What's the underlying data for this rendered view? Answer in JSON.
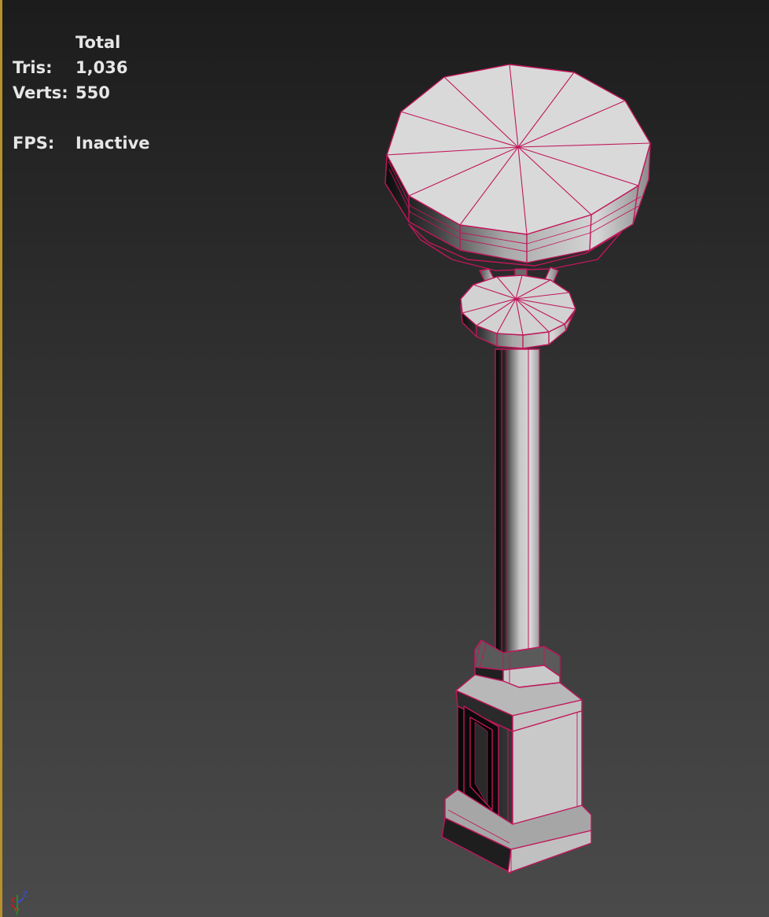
{
  "stats": {
    "column_header": "Total",
    "tris_label": "Tris:",
    "tris_value": "1,036",
    "verts_label": "Verts:",
    "verts_value": "550",
    "fps_label": "FPS:",
    "fps_value": "Inactive"
  },
  "gizmo": {
    "x_label": "x",
    "y_label": "y",
    "z_label": "z"
  },
  "colors": {
    "wireframe": "#c0175a",
    "surface_light": "#dcdcdc",
    "surface_mid": "#9a9a9a",
    "surface_dark": "#0c0c0c",
    "active_border": "#b8902c",
    "stats_text": "#e6e6e6"
  }
}
